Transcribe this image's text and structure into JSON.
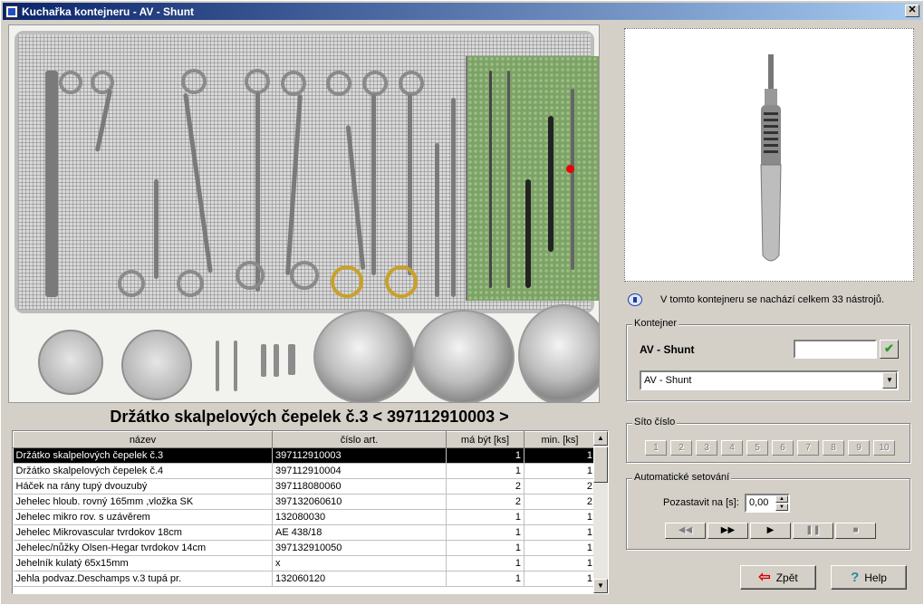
{
  "window": {
    "title": "Kuchařka kontejneru - AV - Shunt",
    "close_glyph": "✕"
  },
  "selected_item_title": "Držátko skalpelových čepelek č.3   < 397112910003 >",
  "table": {
    "headers": [
      "název",
      "číslo art.",
      "má být [ks]",
      "min. [ks]"
    ],
    "rows": [
      {
        "name": "Držátko skalpelových čepelek č.3",
        "code": "397112910003",
        "should": "1",
        "min": "1",
        "selected": true
      },
      {
        "name": "Držátko skalpelových čepelek č.4",
        "code": "397112910004",
        "should": "1",
        "min": "1"
      },
      {
        "name": "Háček na rány tupý dvouzubý",
        "code": "397118080060",
        "should": "2",
        "min": "2"
      },
      {
        "name": "Jehelec hloub. rovný 165mm ,vložka SK",
        "code": "397132060610",
        "should": "2",
        "min": "2"
      },
      {
        "name": "Jehelec mikro rov. s uzávěrem",
        "code": "132080030",
        "should": "1",
        "min": "1"
      },
      {
        "name": "Jehelec Mikrovascular tvrdokov 18cm",
        "code": "AE 438/18",
        "should": "1",
        "min": "1"
      },
      {
        "name": "Jehelec/nůžky Olsen-Hegar tvrdokov 14cm",
        "code": "397132910050",
        "should": "1",
        "min": "1"
      },
      {
        "name": "Jehelník kulatý 65x15mm",
        "code": "x",
        "should": "1",
        "min": "1"
      },
      {
        "name": "Jehla podvaz.Deschamps v.3 tupá pr.",
        "code": "132060120",
        "should": "1",
        "min": "1"
      }
    ]
  },
  "info_text": "V tomto kontejneru se nachází celkem  33 nástrojů.",
  "kontejner": {
    "label": "Kontejner",
    "name": "AV - Shunt",
    "input_value": "",
    "confirm_glyph": "✔",
    "selected_option": "AV - Shunt"
  },
  "sito": {
    "label": "Síto číslo",
    "numbers": [
      "1",
      "2",
      "3",
      "4",
      "5",
      "6",
      "7",
      "8",
      "9",
      "10"
    ]
  },
  "auto": {
    "label": "Automatické setování",
    "pause_label": "Pozastavit na [s]:",
    "pause_value": "0,00",
    "media": [
      "◀◀",
      "▶▶",
      "▶",
      "❚❚",
      "■"
    ]
  },
  "buttons": {
    "back": "Zpět",
    "help": "Help"
  },
  "colors": {
    "titlebar_start": "#0a246a",
    "titlebar_end": "#a6caf0",
    "selection": "#000000"
  }
}
